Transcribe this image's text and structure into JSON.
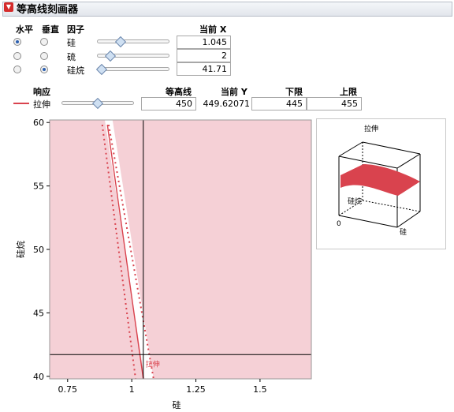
{
  "title": "等高线刻画器",
  "factor_headers": {
    "horizontal": "水平",
    "vertical": "垂直",
    "factor": "因子",
    "current_x": "当前 X"
  },
  "factors": [
    {
      "name": "硅",
      "value": "1.045",
      "horizontal": true,
      "vertical": false,
      "slider": 0.33
    },
    {
      "name": "硫",
      "value": "2",
      "horizontal": false,
      "vertical": false,
      "slider": 0.18
    },
    {
      "name": "硅烷",
      "value": "41.71",
      "horizontal": false,
      "vertical": true,
      "slider": 0.06
    }
  ],
  "response_headers": {
    "response": "响应",
    "contour": "等高线",
    "current_y": "当前 Y",
    "lower": "下限",
    "upper": "上限"
  },
  "response": {
    "name": "拉伸",
    "contour": "450",
    "current_y": "449.62071",
    "lower": "445",
    "upper": "455",
    "slider": 0.5,
    "color": "#d9434e"
  },
  "contour_plot": {
    "x_axis_label": "硅",
    "y_axis_label": "硅烷",
    "x_ticks": [
      "0.75",
      "1",
      "1.25",
      "1.5"
    ],
    "y_ticks": [
      "40",
      "45",
      "50",
      "55",
      "60"
    ],
    "xlim": [
      0.68,
      1.7
    ],
    "ylim": [
      39.8,
      60.2
    ],
    "crosshair": {
      "x": 1.045,
      "y": 41.71
    },
    "contour_label": "拉伸",
    "shade_color": "#f5d0d6"
  },
  "surface_plot": {
    "title": "拉伸",
    "y_label": "硅烷",
    "x_label": "硅",
    "origin_label": "0",
    "surface_color": "#d9434e"
  }
}
